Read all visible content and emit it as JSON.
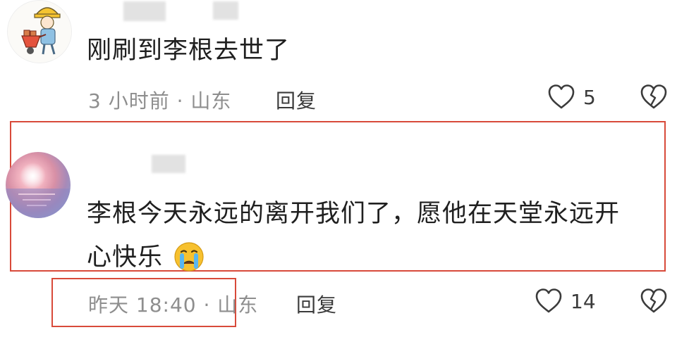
{
  "comments": [
    {
      "text": "刚刷到李根去世了",
      "time": "3 小时前 · 山东",
      "reply_label": "回复",
      "likes": "5",
      "like_icon": "heart-outline-icon",
      "dislike_icon": "broken-heart-icon"
    },
    {
      "text_line1": "李根今天永远的离开我们了，愿他在天堂永远开",
      "text_line2": "心快乐",
      "emoji": "crying-face-icon",
      "time": "昨天 18:40 · 山东",
      "reply_label": "回复",
      "likes": "14",
      "like_icon": "heart-outline-icon",
      "dislike_icon": "broken-heart-icon"
    }
  ],
  "colors": {
    "highlight": "#d84a3a",
    "meta_text": "#8e8e8e",
    "body_text": "#1f1f1f"
  }
}
